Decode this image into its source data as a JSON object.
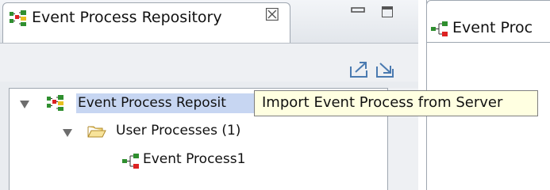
{
  "left_view": {
    "tab_label": "Event Process Repository",
    "close_glyph": "☒",
    "toolbar": {
      "export_icon": "export-to-server-icon",
      "import_icon": "import-from-server-icon"
    }
  },
  "tree": {
    "root": {
      "label": "Event Process Reposit",
      "icon": "repository-icon",
      "expanded": true
    },
    "folder": {
      "label": "User Processes (1)",
      "icon": "folder-open-icon",
      "expanded": true
    },
    "process": {
      "label": "Event Process1",
      "icon": "event-process-icon"
    }
  },
  "right_view": {
    "tab_label": "Event Proc",
    "icon": "event-process-icon"
  },
  "tooltip": {
    "text": "Import Event Process from Server"
  },
  "colors": {
    "selection": "#c7d6f2",
    "tooltip_bg": "#ffffe1",
    "view_bg": "#e9ecf0"
  }
}
